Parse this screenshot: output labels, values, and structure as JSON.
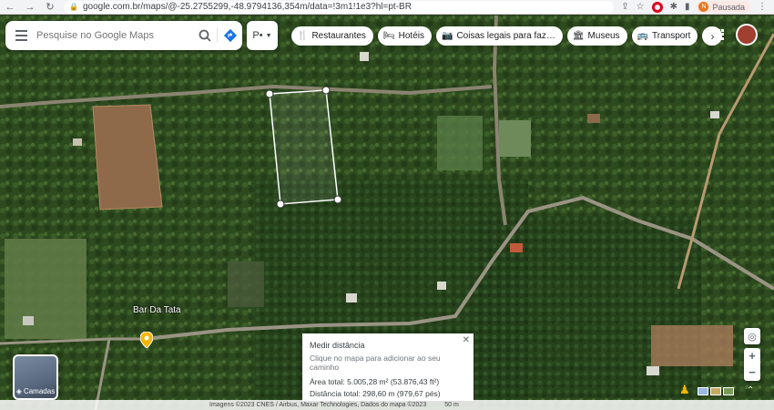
{
  "browser": {
    "url": "google.com.br/maps/@-25.2755299,-48.9794136,354m/data=!3m1!1e3?hl=pt-BR",
    "profile_label": "Pausada",
    "profile_initial": "N"
  },
  "search": {
    "placeholder": "Pesquise no Google Maps",
    "place_type_label": "P•"
  },
  "chips": [
    {
      "label": "Restaurantes",
      "icon": "fork-knife-icon"
    },
    {
      "label": "Hotéis",
      "icon": "bed-icon"
    },
    {
      "label": "Coisas legais para faz…",
      "icon": "camera-icon"
    },
    {
      "label": "Museus",
      "icon": "museum-icon"
    },
    {
      "label": "Transport",
      "icon": "bus-icon"
    }
  ],
  "map": {
    "place_label": "Bar Da Tata",
    "layers_label": "Camadas"
  },
  "measure": {
    "title": "Medir distância",
    "hint": "Clique no mapa para adicionar ao seu caminho",
    "area": "Área total: 5.005,28 m² (53.876,43 ft²)",
    "distance": "Distância total: 298,60 m (979,67 pés)"
  },
  "bottom": {
    "imagery": "Imagens ©2023 CNES / Airbus, Maxar Technologies, Dados do mapa ©2023",
    "scale": "50 m"
  },
  "colors": {
    "accent": "#1a73e8",
    "pin": "#f6b400"
  }
}
